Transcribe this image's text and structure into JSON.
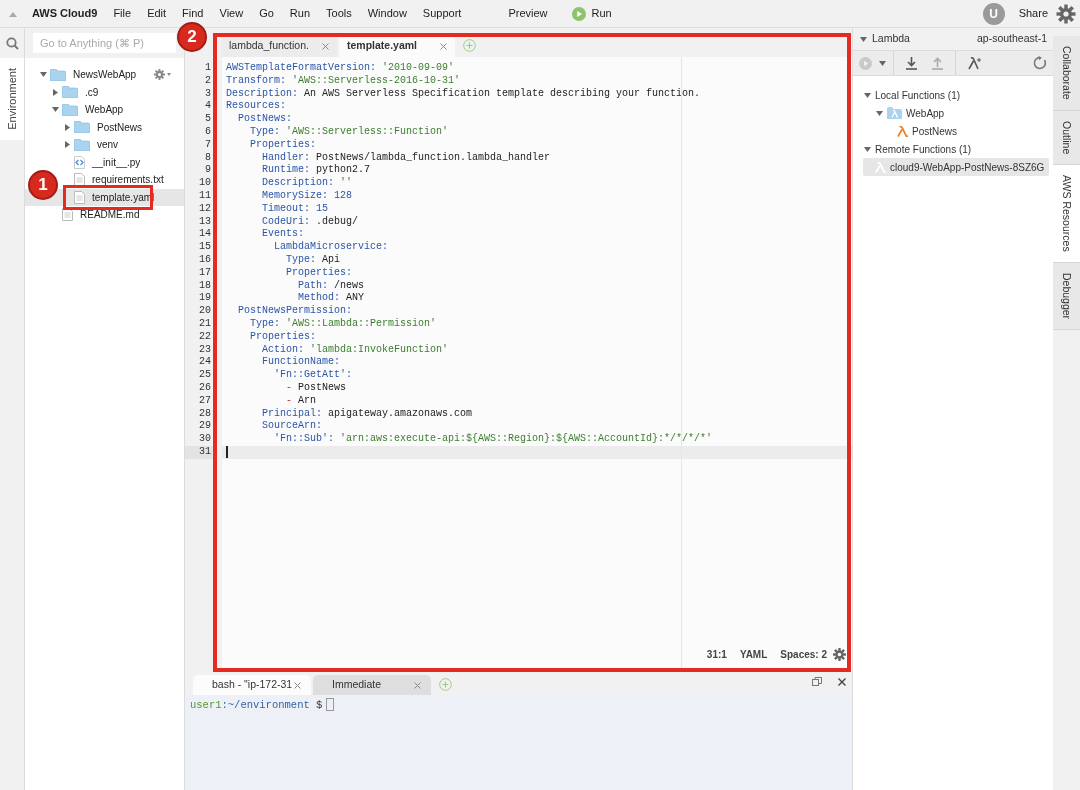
{
  "menu_bar": {
    "app_name": "AWS Cloud9",
    "items": [
      "File",
      "Edit",
      "Find",
      "View",
      "Go",
      "Run",
      "Tools",
      "Window",
      "Support"
    ],
    "preview": "Preview",
    "run": "Run",
    "avatar": "U",
    "share": "Share"
  },
  "left_tabs": [
    {
      "label": "Environment",
      "selected": true
    }
  ],
  "search": {
    "placeholder": "Go to Anything (⌘ P)"
  },
  "file_tree": [
    {
      "name": "NewsWebApp",
      "kind": "folder",
      "expanded": true,
      "selected": false,
      "children": [
        {
          "name": ".c9",
          "kind": "folder",
          "expanded": false,
          "selected": false
        },
        {
          "name": "WebApp",
          "kind": "folder",
          "expanded": true,
          "selected": false,
          "children": [
            {
              "name": "PostNews",
              "kind": "folder",
              "expanded": false,
              "selected": false
            },
            {
              "name": "venv",
              "kind": "folder",
              "expanded": false,
              "selected": false
            },
            {
              "name": "__init__.py",
              "kind": "code",
              "selected": false
            },
            {
              "name": "requirements.txt",
              "kind": "file",
              "selected": false
            },
            {
              "name": "template.yaml",
              "kind": "file",
              "selected": true
            }
          ]
        },
        {
          "name": "README.md",
          "kind": "file",
          "selected": false
        }
      ]
    }
  ],
  "editor": {
    "tabs": [
      {
        "label": "lambda_function.",
        "selected": false
      },
      {
        "label": "template.yaml",
        "selected": true
      }
    ],
    "lines": [
      {
        "number": "1",
        "active": false,
        "tokens": [
          {
            "kind": "key",
            "text": "AWSTemplateFormatVersion:"
          },
          {
            "kind": "string",
            "text": " '2010-09-09'"
          }
        ]
      },
      {
        "number": "2",
        "active": false,
        "tokens": [
          {
            "kind": "key",
            "text": "Transform:"
          },
          {
            "kind": "string",
            "text": " 'AWS::Serverless-2016-10-31'"
          }
        ]
      },
      {
        "number": "3",
        "active": false,
        "tokens": [
          {
            "kind": "key",
            "text": "Description:"
          },
          {
            "kind": "plain",
            "text": " An AWS Serverless Specification template describing your function."
          }
        ]
      },
      {
        "number": "4",
        "active": false,
        "tokens": [
          {
            "kind": "key",
            "text": "Resources:"
          }
        ]
      },
      {
        "number": "5",
        "active": false,
        "tokens": [
          {
            "kind": "key",
            "text": "  PostNews:"
          }
        ]
      },
      {
        "number": "6",
        "active": false,
        "tokens": [
          {
            "kind": "key",
            "text": "    Type:"
          },
          {
            "kind": "string",
            "text": " 'AWS::Serverless::Function'"
          }
        ]
      },
      {
        "number": "7",
        "active": false,
        "tokens": [
          {
            "kind": "key",
            "text": "    Properties:"
          }
        ]
      },
      {
        "number": "8",
        "active": false,
        "tokens": [
          {
            "kind": "key",
            "text": "      Handler:"
          },
          {
            "kind": "plain",
            "text": " PostNews/lambda_function.lambda_handler"
          }
        ]
      },
      {
        "number": "9",
        "active": false,
        "tokens": [
          {
            "kind": "key",
            "text": "      Runtime:"
          },
          {
            "kind": "plain",
            "text": " python2.7"
          }
        ]
      },
      {
        "number": "10",
        "active": false,
        "tokens": [
          {
            "kind": "key",
            "text": "      Description:"
          },
          {
            "kind": "string",
            "text": " ''"
          }
        ]
      },
      {
        "number": "11",
        "active": false,
        "tokens": [
          {
            "kind": "key",
            "text": "      MemorySize:"
          },
          {
            "kind": "number",
            "text": " 128"
          }
        ]
      },
      {
        "number": "12",
        "active": false,
        "tokens": [
          {
            "kind": "key",
            "text": "      Timeout:"
          },
          {
            "kind": "number",
            "text": " 15"
          }
        ]
      },
      {
        "number": "13",
        "active": false,
        "tokens": [
          {
            "kind": "key",
            "text": "      CodeUri:"
          },
          {
            "kind": "plain",
            "text": " .debug/"
          }
        ]
      },
      {
        "number": "14",
        "active": false,
        "tokens": [
          {
            "kind": "key",
            "text": "      Events:"
          }
        ]
      },
      {
        "number": "15",
        "active": false,
        "tokens": [
          {
            "kind": "key",
            "text": "        LambdaMicroservice:"
          }
        ]
      },
      {
        "number": "16",
        "active": false,
        "tokens": [
          {
            "kind": "key",
            "text": "          Type:"
          },
          {
            "kind": "plain",
            "text": " Api"
          }
        ]
      },
      {
        "number": "17",
        "active": false,
        "tokens": [
          {
            "kind": "key",
            "text": "          Properties:"
          }
        ]
      },
      {
        "number": "18",
        "active": false,
        "tokens": [
          {
            "kind": "key",
            "text": "            Path:"
          },
          {
            "kind": "plain",
            "text": " /news"
          }
        ]
      },
      {
        "number": "19",
        "active": false,
        "tokens": [
          {
            "kind": "key",
            "text": "            Method:"
          },
          {
            "kind": "plain",
            "text": " ANY"
          }
        ]
      },
      {
        "number": "20",
        "active": false,
        "tokens": [
          {
            "kind": "key",
            "text": "  PostNewsPermission:"
          }
        ]
      },
      {
        "number": "21",
        "active": false,
        "tokens": [
          {
            "kind": "key",
            "text": "    Type:"
          },
          {
            "kind": "string",
            "text": " 'AWS::Lambda::Permission'"
          }
        ]
      },
      {
        "number": "22",
        "active": false,
        "tokens": [
          {
            "kind": "key",
            "text": "    Properties:"
          }
        ]
      },
      {
        "number": "23",
        "active": false,
        "tokens": [
          {
            "kind": "key",
            "text": "      Action:"
          },
          {
            "kind": "string",
            "text": " 'lambda:InvokeFunction'"
          }
        ]
      },
      {
        "number": "24",
        "active": false,
        "tokens": [
          {
            "kind": "key",
            "text": "      FunctionName:"
          }
        ]
      },
      {
        "number": "25",
        "active": false,
        "tokens": [
          {
            "kind": "key",
            "text": "        'Fn::GetAtt':"
          }
        ]
      },
      {
        "number": "26",
        "active": false,
        "tokens": [
          {
            "kind": "dash",
            "text": "          -"
          },
          {
            "kind": "plain",
            "text": " PostNews"
          }
        ]
      },
      {
        "number": "27",
        "active": false,
        "tokens": [
          {
            "kind": "dash",
            "text": "          -"
          },
          {
            "kind": "plain",
            "text": " Arn"
          }
        ]
      },
      {
        "number": "28",
        "active": false,
        "tokens": [
          {
            "kind": "key",
            "text": "      Principal:"
          },
          {
            "kind": "plain",
            "text": " apigateway.amazonaws.com"
          }
        ]
      },
      {
        "number": "29",
        "active": false,
        "tokens": [
          {
            "kind": "key",
            "text": "      SourceArn:"
          }
        ]
      },
      {
        "number": "30",
        "active": false,
        "tokens": [
          {
            "kind": "key",
            "text": "        'Fn::Sub':"
          },
          {
            "kind": "string",
            "text": " 'arn:aws:execute-api:${AWS::Region}:${AWS::AccountId}:*/*/*/*'"
          }
        ]
      },
      {
        "number": "31",
        "active": true
      }
    ],
    "status": {
      "position": "31:1",
      "language": "YAML",
      "indent": "Spaces: 2"
    }
  },
  "terminal": {
    "tabs": [
      {
        "label": "bash - \"ip-172-31",
        "selected": true
      },
      {
        "label": "Immediate",
        "selected": false
      }
    ],
    "prompt": {
      "user": "user1",
      "path": ":~/environment",
      "symbol": "$"
    }
  },
  "aws_panel": {
    "title": "Lambda",
    "region": "ap-southeast-1",
    "tree": [
      {
        "label": "Local Functions (1)",
        "kind": "group",
        "expanded": true,
        "selected": false,
        "children": [
          {
            "label": "WebApp",
            "kind": "app",
            "expanded": true,
            "selected": false,
            "children": [
              {
                "label": "PostNews",
                "kind": "function",
                "selected": false
              }
            ]
          }
        ]
      },
      {
        "label": "Remote Functions (1)",
        "kind": "group",
        "expanded": true,
        "selected": false,
        "children": [
          {
            "label": "cloud9-WebApp-PostNews-8SZ6G",
            "kind": "remote",
            "selected": true
          }
        ]
      }
    ]
  },
  "right_tabs": [
    {
      "label": "Collaborate",
      "selected": false
    },
    {
      "label": "Outline",
      "selected": false
    },
    {
      "label": "AWS Resources",
      "selected": true
    },
    {
      "label": "Debugger",
      "selected": false
    }
  ],
  "annotations": [
    {
      "label": "1"
    },
    {
      "label": "2"
    }
  ]
}
